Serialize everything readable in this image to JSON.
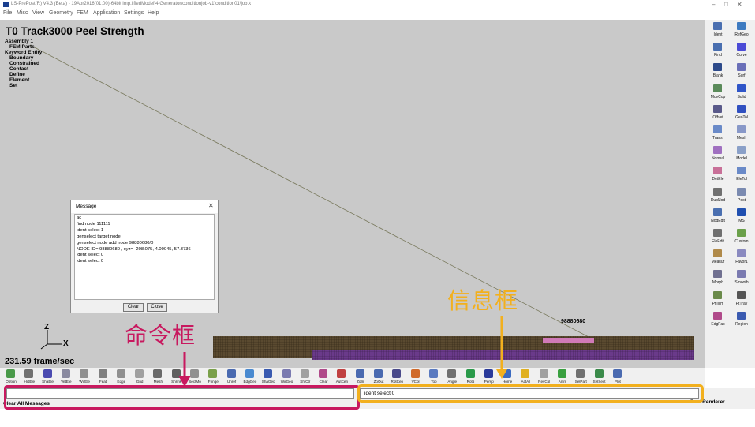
{
  "window": {
    "title": "LS-PrePost(R) V4.3 (Beta) - 19Apr2016(01:00)-64bit imp.lifiedModel\\4-Generator\\conditionjob-v1\\condition01\\job.k",
    "minimize": "–",
    "restore": "□",
    "close": "✕"
  },
  "menu": [
    "File",
    "Misc",
    "View",
    "Geometry",
    "FEM",
    "Application",
    "Settings",
    "Help"
  ],
  "viewport": {
    "title": "T0 Track3000 Peel Strength",
    "tree": [
      "Assembly 1",
      "FEM Parts",
      "Keyword Entity",
      "Boundary",
      "Constrained",
      "Contact",
      "Define",
      "Element",
      "Set"
    ],
    "node_label": "98880680",
    "fps": "231.59 frame/sec",
    "axis_z": "Z",
    "axis_x": "X"
  },
  "message_dialog": {
    "title": "Message",
    "close_glyph": "✕",
    "lines": [
      "ac",
      "find node 111111",
      "ident select 1",
      "genselect target node",
      "genselect node add node 98880680/0",
      "NODE ID= 98880680 ,  xyz=  -208.075, 4.00045, 57.3736",
      "ident select 0",
      "ident select 0"
    ],
    "clear_label": "Clear",
    "close_label": "Close"
  },
  "annotations": {
    "command_label": "命令框",
    "info_label": "信息框",
    "command_color": "#c8195f",
    "info_color": "#f2b01e"
  },
  "right_toolbar": [
    {
      "label": "Ident",
      "icon": "ident-icon",
      "color": "#4a6fb0"
    },
    {
      "label": "RefGeo",
      "icon": "refgeo-icon",
      "color": "#3d7ac0"
    },
    {
      "label": "Find",
      "icon": "find-icon",
      "color": "#4a6fb0"
    },
    {
      "label": "Curve",
      "icon": "curve-icon",
      "color": "#4b4bd6"
    },
    {
      "label": "Blank",
      "icon": "blank-icon",
      "color": "#2d4a8a"
    },
    {
      "label": "Surf",
      "icon": "surf-icon",
      "color": "#6a6fb8"
    },
    {
      "label": "MovCop",
      "icon": "movcop-icon",
      "color": "#5a8a5a"
    },
    {
      "label": "Solid",
      "icon": "solid-icon",
      "color": "#2f55c8"
    },
    {
      "label": "Offset",
      "icon": "offset-icon",
      "color": "#5a5a8a"
    },
    {
      "label": "GeoTol",
      "icon": "geotol-icon",
      "color": "#3050c0"
    },
    {
      "label": "Transf",
      "icon": "transf-icon",
      "color": "#6a8ac8"
    },
    {
      "label": "Mesh",
      "icon": "mesh-icon",
      "color": "#8898c8"
    },
    {
      "label": "Normal",
      "icon": "normal-icon",
      "color": "#a070c0"
    },
    {
      "label": "Model",
      "icon": "model-icon",
      "color": "#8aa0c8"
    },
    {
      "label": "DetEle",
      "icon": "detele-icon",
      "color": "#c87098"
    },
    {
      "label": "EleTol",
      "icon": "eletol-icon",
      "color": "#6a8ac8"
    },
    {
      "label": "DupNod",
      "icon": "dupnod-icon",
      "color": "#707070"
    },
    {
      "label": "Post",
      "icon": "post-icon",
      "color": "#7a8ab0"
    },
    {
      "label": "NodEdit",
      "icon": "nodedit-icon",
      "color": "#4a6fb0"
    },
    {
      "label": "MS",
      "icon": "ms-icon",
      "color": "#1f4fb0"
    },
    {
      "label": "EleEdit",
      "icon": "eleedit-icon",
      "color": "#707070"
    },
    {
      "label": "Custom",
      "icon": "custom-icon",
      "color": "#6aa04a"
    },
    {
      "label": "Measur",
      "icon": "measur-icon",
      "color": "#b08a4a"
    },
    {
      "label": "Favor1",
      "icon": "favor-icon",
      "color": "#8a8ac0"
    },
    {
      "label": "Morph",
      "icon": "morph-icon",
      "color": "#707090"
    },
    {
      "label": "Smooth",
      "icon": "smooth-icon",
      "color": "#7a7ab0"
    },
    {
      "label": "PtTrim",
      "icon": "pttrim-icon",
      "color": "#6a8a4a"
    },
    {
      "label": "PtTrav",
      "icon": "pttrav-icon",
      "color": "#555555"
    },
    {
      "label": "EdgFac",
      "icon": "edgfac-icon",
      "color": "#b04a8a"
    },
    {
      "label": "Region",
      "icon": "region-icon",
      "color": "#3a5ab0"
    }
  ],
  "bottom_toolbar": [
    {
      "label": "Option",
      "icon": "option-icon",
      "color": "#4a9a4a"
    },
    {
      "label": "HidEle",
      "icon": "hidele-icon",
      "color": "#707070"
    },
    {
      "label": "ShaEle",
      "icon": "shaele-icon",
      "color": "#4a4ab0"
    },
    {
      "label": "VetEle",
      "icon": "vetele-icon",
      "color": "#8a8aa0"
    },
    {
      "label": "WirEle",
      "icon": "wirele-icon",
      "color": "#909090"
    },
    {
      "label": "Feat",
      "icon": "feat-icon",
      "color": "#808080"
    },
    {
      "label": "Edge",
      "icon": "edge-icon",
      "color": "#909090"
    },
    {
      "label": "Grid",
      "icon": "grid-icon",
      "color": "#a0a0a0"
    },
    {
      "label": "Mesh",
      "icon": "mesh-view-icon",
      "color": "#6a6a6a"
    },
    {
      "label": "Shrink",
      "icon": "shrink-icon",
      "color": "#606060"
    },
    {
      "label": "SectMo",
      "icon": "sectmo-icon",
      "color": "#909090"
    },
    {
      "label": "Fringe",
      "icon": "fringe-icon",
      "color": "#7aa04a"
    },
    {
      "label": "Unref",
      "icon": "unref-icon",
      "color": "#4a6ab0"
    },
    {
      "label": "EdgGeo",
      "icon": "edggeo-icon",
      "color": "#4a8ad0"
    },
    {
      "label": "ShaGeo",
      "icon": "shageo-icon",
      "color": "#3a5ab0"
    },
    {
      "label": "WirGeo",
      "icon": "wirgeo-icon",
      "color": "#7a7ab0"
    },
    {
      "label": "ShfCtr",
      "icon": "shfctr-icon",
      "color": "#a0a0a0"
    },
    {
      "label": "Clear",
      "icon": "clear-icon",
      "color": "#b04a8a"
    },
    {
      "label": "AutCen",
      "icon": "autcen-icon",
      "color": "#c04040"
    },
    {
      "label": "ZoIn",
      "icon": "zoin-icon",
      "color": "#4a6ab0"
    },
    {
      "label": "ZoOut",
      "icon": "zoout-icon",
      "color": "#4a6ab0"
    },
    {
      "label": "RotCen",
      "icon": "rotcen-icon",
      "color": "#4a4a8a"
    },
    {
      "label": "VCol",
      "icon": "vcol-icon",
      "color": "#d06a2a"
    },
    {
      "label": "Top",
      "icon": "top-icon",
      "color": "#5a7ac0"
    },
    {
      "label": "Angle",
      "icon": "angle-icon",
      "color": "#707070"
    },
    {
      "label": "Rot5",
      "icon": "rot-icon",
      "color": "#2a9a4a"
    },
    {
      "label": "Persp",
      "icon": "persp-icon",
      "color": "#2a3a9a"
    },
    {
      "label": "Home",
      "icon": "home-icon",
      "color": "#3a6ac0"
    },
    {
      "label": "ActAll",
      "icon": "actall-icon",
      "color": "#e0b020"
    },
    {
      "label": "RevCol",
      "icon": "revcol-icon",
      "color": "#a0a0a0"
    },
    {
      "label": "Anim",
      "icon": "anim-icon",
      "color": "#3aa040"
    },
    {
      "label": "SelPart",
      "icon": "selpart-icon",
      "color": "#707070"
    },
    {
      "label": "SelSect",
      "icon": "selsect-icon",
      "color": "#3a8a4a"
    },
    {
      "label": "Plot",
      "icon": "plot-icon",
      "color": "#4a6ab0"
    }
  ],
  "command_input": {
    "value": ""
  },
  "info_box": {
    "text": "ident select 0"
  },
  "status": {
    "left": "Clear All Messages",
    "right": "Fast Renderer"
  }
}
